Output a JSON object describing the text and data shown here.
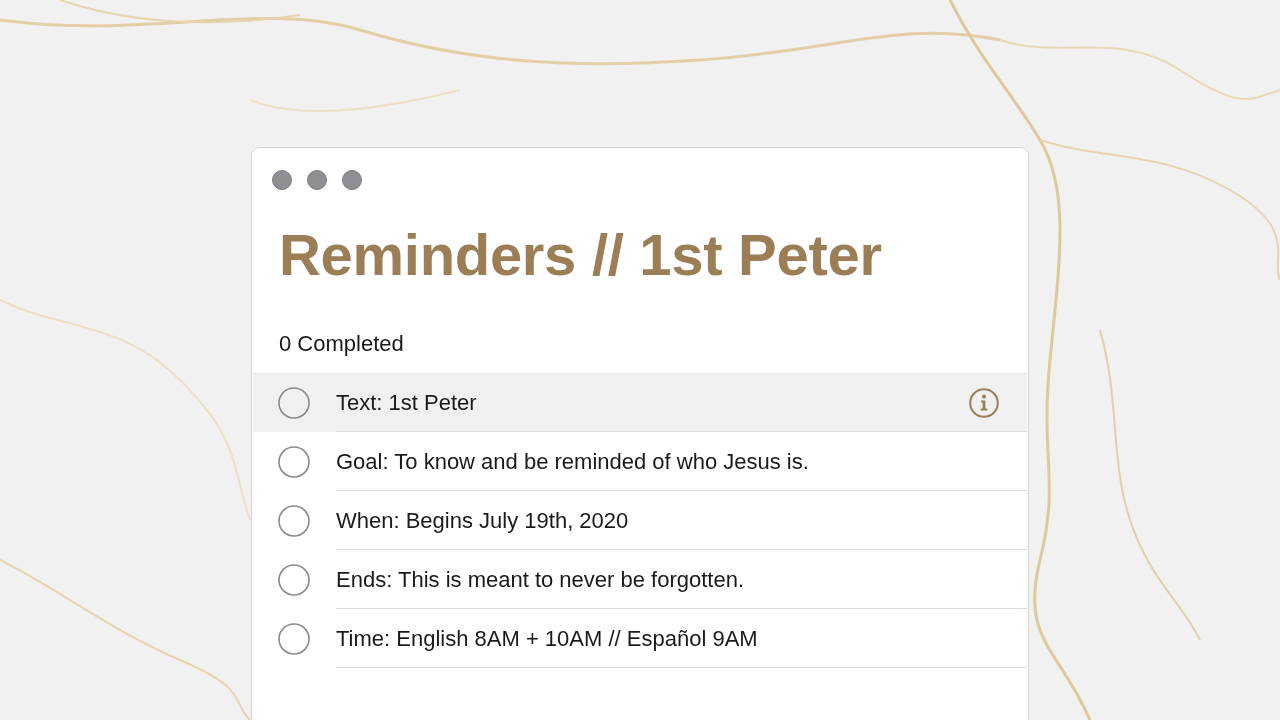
{
  "window": {
    "title": "Reminders // 1st Peter"
  },
  "completed_count": "0 Completed",
  "reminders": [
    {
      "text": "Text: 1st Peter",
      "selected": true,
      "checked": false
    },
    {
      "text": "Goal: To know and be reminded of who Jesus is.",
      "selected": false,
      "checked": false
    },
    {
      "text": "When: Begins July 19th, 2020",
      "selected": false,
      "checked": false
    },
    {
      "text": "Ends: This is meant to never be forgotten.",
      "selected": false,
      "checked": false
    },
    {
      "text": "Time: English 8AM + 10AM // Español 9AM",
      "selected": false,
      "checked": false
    }
  ]
}
